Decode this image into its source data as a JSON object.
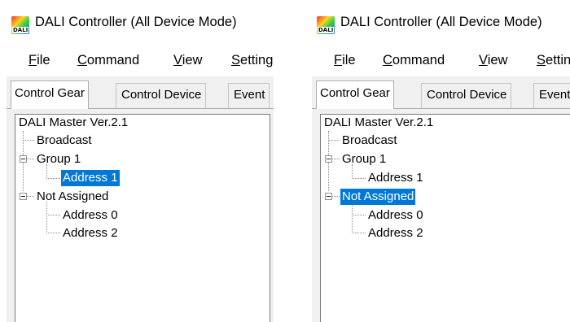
{
  "app": {
    "icon_text": "DALI",
    "title": "DALI Controller (All Device Mode)"
  },
  "menu": [
    "File",
    "Command",
    "View",
    "Settings"
  ],
  "tabs": [
    "Control Gear",
    "Control Device",
    "Event"
  ],
  "tree": {
    "root": "DALI Master Ver.2.1",
    "broadcast": "Broadcast",
    "group1": "Group 1",
    "address1": "Address 1",
    "not_assigned": "Not Assigned",
    "address0": "Address 0",
    "address2": "Address 2"
  },
  "screens": [
    {
      "selected_node": "Address 1"
    },
    {
      "selected_node": "Not Assigned"
    }
  ],
  "colors": {
    "selection": "#0078d7"
  }
}
